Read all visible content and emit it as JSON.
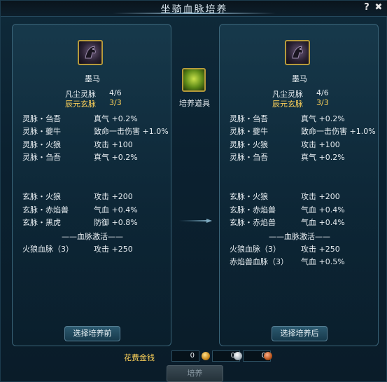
{
  "title": "坐骑血脉培养",
  "help_label": "?",
  "close_label": "✖",
  "left_panel": {
    "mount_name": "墨马",
    "grade": [
      {
        "label": "凡尘灵脉",
        "value": "4/6",
        "highlight": false
      },
      {
        "label": "辰元玄脉",
        "value": "3/3",
        "highlight": true
      }
    ],
    "ling_stats": [
      {
        "name": "灵脉・刍吾",
        "value": "真气 +0.2%"
      },
      {
        "name": "灵脉・夔牛",
        "value": "致命一击伤害 +1.0%"
      },
      {
        "name": "灵脉・火狼",
        "value": "攻击 +100"
      },
      {
        "name": "灵脉・刍吾",
        "value": "真气 +0.2%"
      }
    ],
    "xuan_stats": [
      {
        "name": "玄脉・火狼",
        "value": "攻击 +200"
      },
      {
        "name": "玄脉・赤焰兽",
        "value": "气血 +0.4%"
      },
      {
        "name": "玄脉・黑虎",
        "value": "防御 +0.8%"
      }
    ],
    "activation_title": "——血脉激活——",
    "activations": [
      {
        "name": "火狼血脉（3）",
        "value": "攻击 +250"
      }
    ],
    "button_label": "选择培养前"
  },
  "right_panel": {
    "mount_name": "墨马",
    "grade": [
      {
        "label": "凡尘灵脉",
        "value": "4/6",
        "highlight": false
      },
      {
        "label": "辰元玄脉",
        "value": "3/3",
        "highlight": true
      }
    ],
    "ling_stats": [
      {
        "name": "灵脉・刍吾",
        "value": "真气 +0.2%"
      },
      {
        "name": "灵脉・夔牛",
        "value": "致命一击伤害 +1.0%"
      },
      {
        "name": "灵脉・火狼",
        "value": "攻击 +100"
      },
      {
        "name": "灵脉・刍吾",
        "value": "真气 +0.2%"
      }
    ],
    "xuan_stats": [
      {
        "name": "玄脉・火狼",
        "value": "攻击 +200"
      },
      {
        "name": "玄脉・赤焰兽",
        "value": "气血 +0.4%"
      },
      {
        "name": "玄脉・赤焰兽",
        "value": "气血 +0.4%"
      }
    ],
    "activation_title": "——血脉激活——",
    "activations": [
      {
        "name": "火狼血脉（3）",
        "value": "攻击 +250"
      },
      {
        "name": "赤焰兽血脉（3）",
        "value": "气血 +0.5%"
      }
    ],
    "button_label": "选择培养后"
  },
  "item": {
    "label": "培养道具",
    "icon": "fruit-icon"
  },
  "cost": {
    "label": "花费金钱",
    "gold": "0",
    "silver": "0",
    "copper": "0"
  },
  "train_button": "培养",
  "colors": {
    "highlight": "#ffd35a",
    "panel_border": "#3a6478"
  }
}
